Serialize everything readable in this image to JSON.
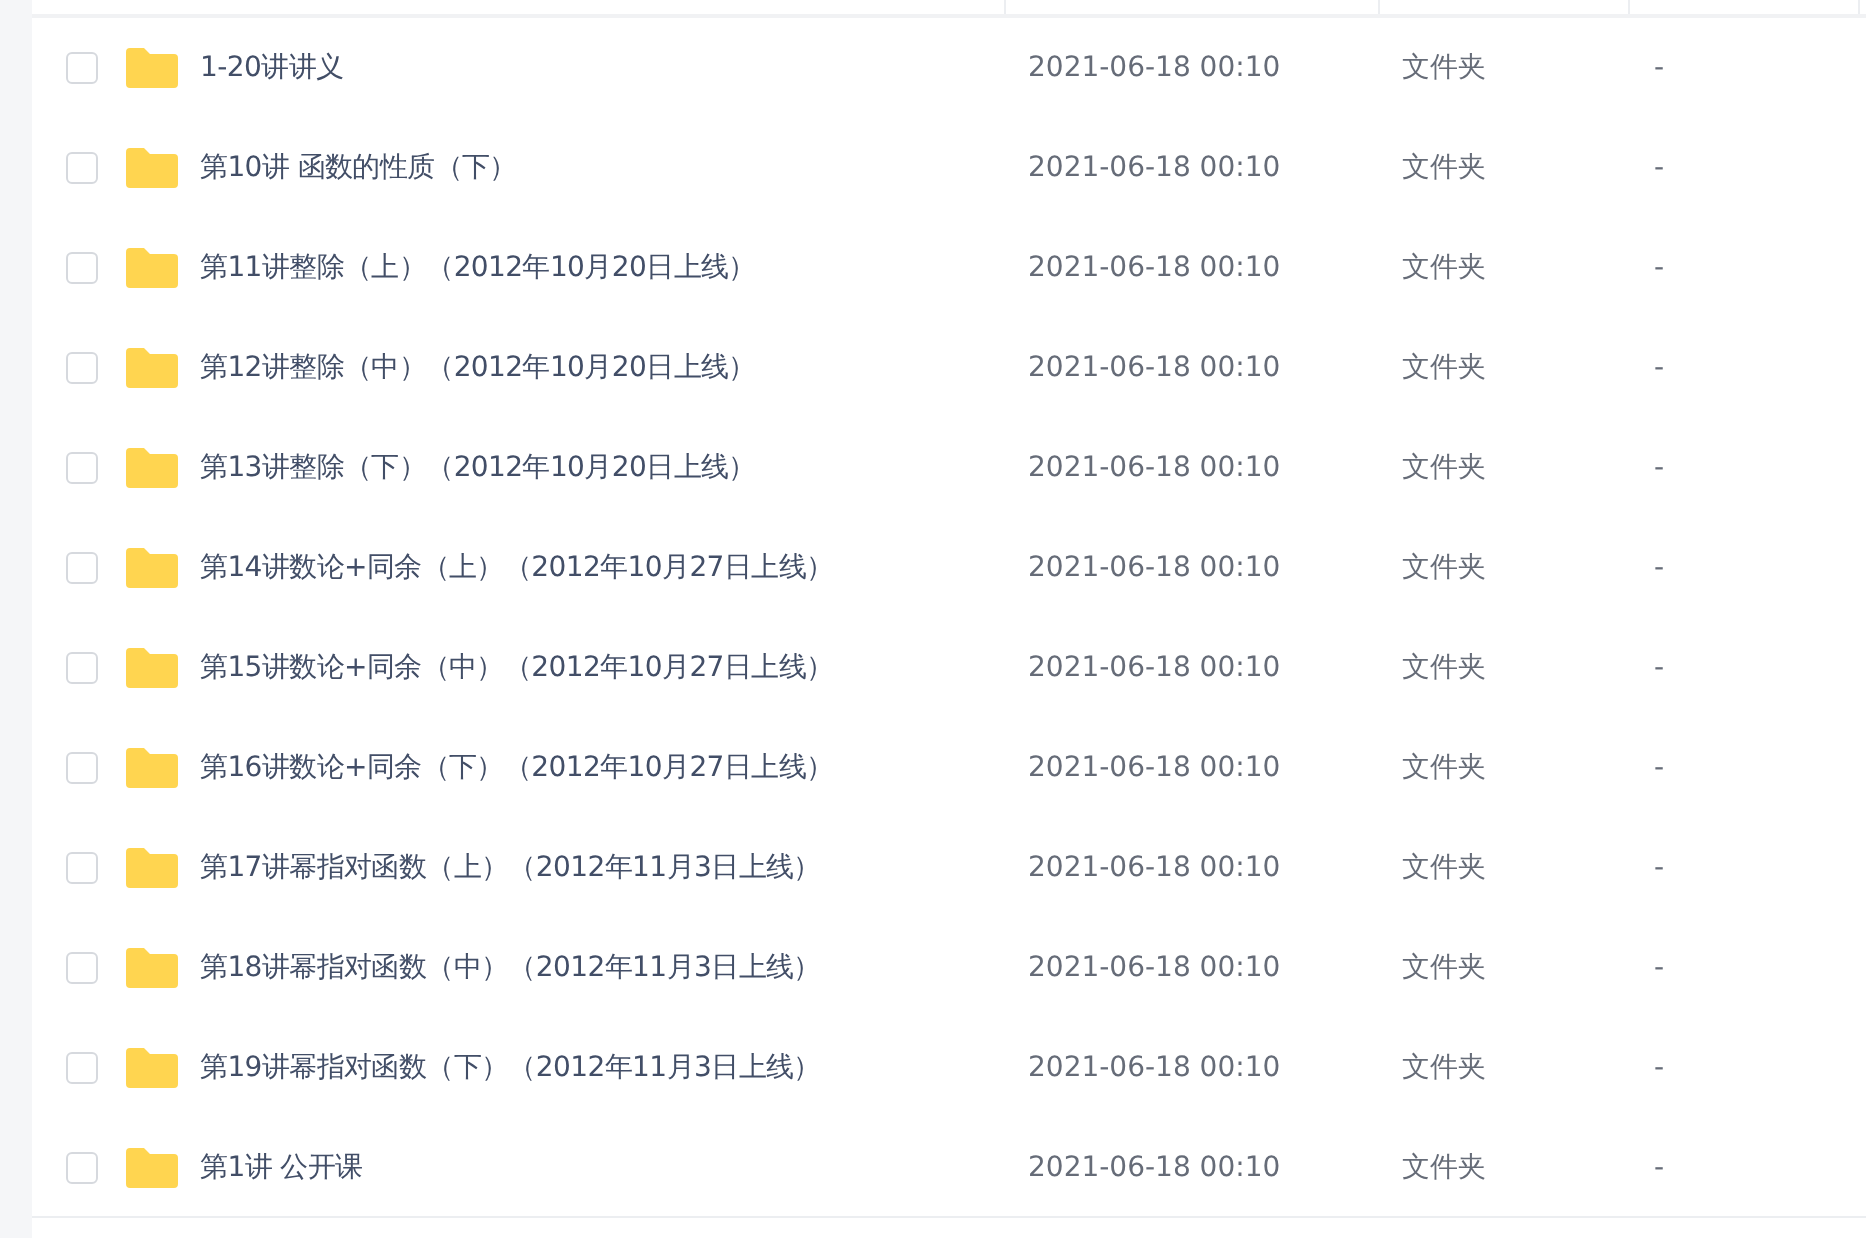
{
  "files": [
    {
      "name": "1-20讲讲义",
      "modified": "2021-06-18 00:10",
      "type": "文件夹",
      "size": "-",
      "checked": false
    },
    {
      "name": "第10讲 函数的性质（下）",
      "modified": "2021-06-18 00:10",
      "type": "文件夹",
      "size": "-",
      "checked": false
    },
    {
      "name": "第11讲整除（上）（2012年10月20日上线）",
      "modified": "2021-06-18 00:10",
      "type": "文件夹",
      "size": "-",
      "checked": false
    },
    {
      "name": "第12讲整除（中）（2012年10月20日上线）",
      "modified": "2021-06-18 00:10",
      "type": "文件夹",
      "size": "-",
      "checked": false
    },
    {
      "name": "第13讲整除（下）（2012年10月20日上线）",
      "modified": "2021-06-18 00:10",
      "type": "文件夹",
      "size": "-",
      "checked": false
    },
    {
      "name": "第14讲数论+同余（上）（2012年10月27日上线）",
      "modified": "2021-06-18 00:10",
      "type": "文件夹",
      "size": "-",
      "checked": false
    },
    {
      "name": "第15讲数论+同余（中）（2012年10月27日上线）",
      "modified": "2021-06-18 00:10",
      "type": "文件夹",
      "size": "-",
      "checked": false
    },
    {
      "name": "第16讲数论+同余（下）（2012年10月27日上线）",
      "modified": "2021-06-18 00:10",
      "type": "文件夹",
      "size": "-",
      "checked": false
    },
    {
      "name": "第17讲幂指对函数（上）（2012年11月3日上线）",
      "modified": "2021-06-18 00:10",
      "type": "文件夹",
      "size": "-",
      "checked": false
    },
    {
      "name": "第18讲幂指对函数（中）（2012年11月3日上线）",
      "modified": "2021-06-18 00:10",
      "type": "文件夹",
      "size": "-",
      "checked": false
    },
    {
      "name": "第19讲幂指对函数（下）（2012年11月3日上线）",
      "modified": "2021-06-18 00:10",
      "type": "文件夹",
      "size": "-",
      "checked": false
    },
    {
      "name": "第1讲 公开课",
      "modified": "2021-06-18 00:10",
      "type": "文件夹",
      "size": "-",
      "checked": false
    }
  ]
}
